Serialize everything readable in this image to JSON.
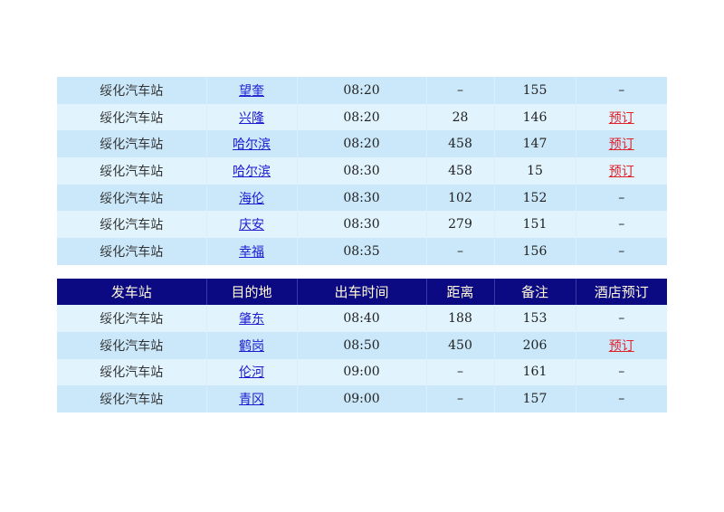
{
  "table1": {
    "rows": [
      {
        "station": "绥化汽车站",
        "destination": "望奎",
        "time": "08:20",
        "distance": "–",
        "note": "155",
        "hotel": "–",
        "hotel_link": false
      },
      {
        "station": "绥化汽车站",
        "destination": "兴隆",
        "time": "08:20",
        "distance": "28",
        "note": "146",
        "hotel": "预订",
        "hotel_link": true
      },
      {
        "station": "绥化汽车站",
        "destination": "哈尔滨",
        "time": "08:20",
        "distance": "458",
        "note": "147",
        "hotel": "预订",
        "hotel_link": true
      },
      {
        "station": "绥化汽车站",
        "destination": "哈尔滨",
        "time": "08:30",
        "distance": "458",
        "note": "15",
        "hotel": "预订",
        "hotel_link": true
      },
      {
        "station": "绥化汽车站",
        "destination": "海伦",
        "time": "08:30",
        "distance": "102",
        "note": "152",
        "hotel": "–",
        "hotel_link": false
      },
      {
        "station": "绥化汽车站",
        "destination": "庆安",
        "time": "08:30",
        "distance": "279",
        "note": "151",
        "hotel": "–",
        "hotel_link": false
      },
      {
        "station": "绥化汽车站",
        "destination": "幸福",
        "time": "08:35",
        "distance": "–",
        "note": "156",
        "hotel": "–",
        "hotel_link": false
      }
    ]
  },
  "table2": {
    "headers": [
      "发车站",
      "目的地",
      "出车时间",
      "距离",
      "备注",
      "酒店预订"
    ],
    "rows": [
      {
        "station": "绥化汽车站",
        "destination": "肇东",
        "time": "08:40",
        "distance": "188",
        "note": "153",
        "hotel": "–",
        "hotel_link": false
      },
      {
        "station": "绥化汽车站",
        "destination": "鹤岗",
        "time": "08:50",
        "distance": "450",
        "note": "206",
        "hotel": "预订",
        "hotel_link": true
      },
      {
        "station": "绥化汽车站",
        "destination": "伦河",
        "time": "09:00",
        "distance": "–",
        "note": "161",
        "hotel": "–",
        "hotel_link": false
      },
      {
        "station": "绥化汽车站",
        "destination": "青冈",
        "time": "09:00",
        "distance": "–",
        "note": "157",
        "hotel": "–",
        "hotel_link": false
      }
    ]
  },
  "colors": {
    "header_bg": "#0b0a82",
    "header_text": "#fff8dc",
    "row_odd": "#cbe8fa",
    "row_even": "#e1f3fd",
    "link": "#1b1bd1",
    "booking_link": "#e0222a"
  }
}
